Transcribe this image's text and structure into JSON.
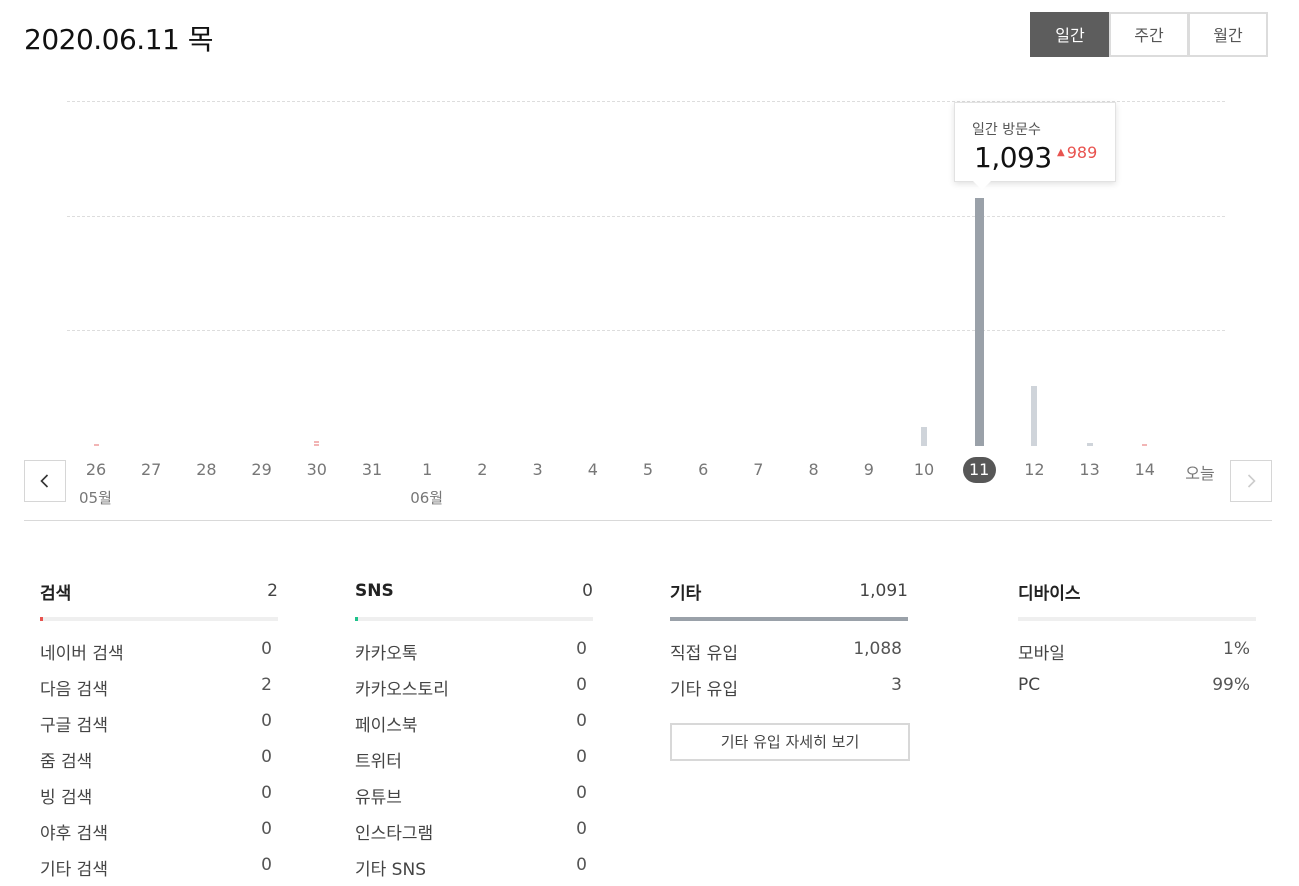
{
  "page": {
    "title": "2020.06.11 목"
  },
  "period_tabs": [
    {
      "label": "일간",
      "active": true
    },
    {
      "label": "주간",
      "active": false
    },
    {
      "label": "월간",
      "active": false
    }
  ],
  "tooltip": {
    "label": "일간 방문수",
    "value": "1,093",
    "delta": "989"
  },
  "colors": {
    "bar": "#cfd4da",
    "bar_selected": "#9aa1a9",
    "delta": "#e8534f",
    "search_accent": "#e8534f",
    "sns_accent": "#1ec28b",
    "other_accent": "#9aa1a9"
  },
  "chart_data": {
    "type": "bar",
    "categories": [
      "26",
      "27",
      "28",
      "29",
      "30",
      "31",
      "1",
      "2",
      "3",
      "4",
      "5",
      "6",
      "7",
      "8",
      "9",
      "10",
      "11",
      "12",
      "13",
      "14",
      "오늘"
    ],
    "values": [
      2,
      0,
      0,
      0,
      5,
      0,
      0,
      0,
      0,
      0,
      0,
      0,
      0,
      0,
      0,
      85,
      1093,
      265,
      12,
      4,
      0
    ],
    "selected": "11",
    "ylim": [
      0,
      1090
    ],
    "grid": true
  },
  "timeline": {
    "months": [
      {
        "label": "05월",
        "at": "26"
      },
      {
        "label": "06월",
        "at": "1"
      }
    ],
    "prev_icon": "chevron-left-icon",
    "next_icon": "chevron-right-icon"
  },
  "stats": {
    "search": {
      "title": "검색",
      "total": "2",
      "rows": [
        {
          "label": "네이버 검색",
          "value": "0"
        },
        {
          "label": "다음 검색",
          "value": "2"
        },
        {
          "label": "구글 검색",
          "value": "0"
        },
        {
          "label": "줌 검색",
          "value": "0"
        },
        {
          "label": "빙 검색",
          "value": "0"
        },
        {
          "label": "야후 검색",
          "value": "0"
        },
        {
          "label": "기타 검색",
          "value": "0"
        }
      ]
    },
    "sns": {
      "title": "SNS",
      "total": "0",
      "rows": [
        {
          "label": "카카오톡",
          "value": "0"
        },
        {
          "label": "카카오스토리",
          "value": "0"
        },
        {
          "label": "페이스북",
          "value": "0"
        },
        {
          "label": "트위터",
          "value": "0"
        },
        {
          "label": "유튜브",
          "value": "0"
        },
        {
          "label": "인스타그램",
          "value": "0"
        },
        {
          "label": "기타 SNS",
          "value": "0"
        }
      ]
    },
    "other": {
      "title": "기타",
      "total": "1,091",
      "rows": [
        {
          "label": "직접 유입",
          "value": "1,088"
        },
        {
          "label": "기타 유입",
          "value": "3"
        }
      ],
      "more_label": "기타 유입 자세히 보기"
    },
    "device": {
      "title": "디바이스",
      "rows": [
        {
          "label": "모바일",
          "value": "1%"
        },
        {
          "label": "PC",
          "value": "99%"
        }
      ]
    }
  }
}
